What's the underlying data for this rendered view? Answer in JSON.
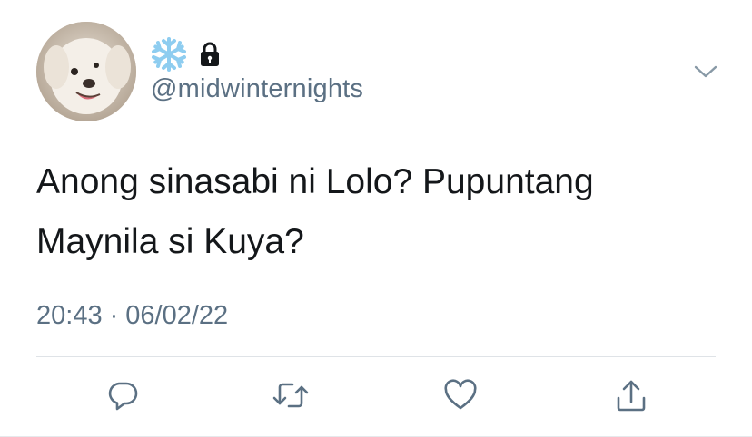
{
  "tweet": {
    "display_name_emoji": "snowflake-icon",
    "protected_icon": "lock-icon",
    "handle": "@midwinternights",
    "text_line1": "Anong sinasabi ni Lolo? Pupuntang",
    "text_line2": "Maynila si Kuya?",
    "time": "20:43",
    "separator": "·",
    "date": "06/02/22"
  },
  "actions": [
    {
      "icon": "reply-icon"
    },
    {
      "icon": "retweet-icon"
    },
    {
      "icon": "like-icon"
    },
    {
      "icon": "share-icon"
    }
  ],
  "colors": {
    "text": "#14171a",
    "secondary": "#5b7083",
    "icon": "#5b7083",
    "divider": "#dfe3e7",
    "snowflake": "#8ecdf0"
  }
}
